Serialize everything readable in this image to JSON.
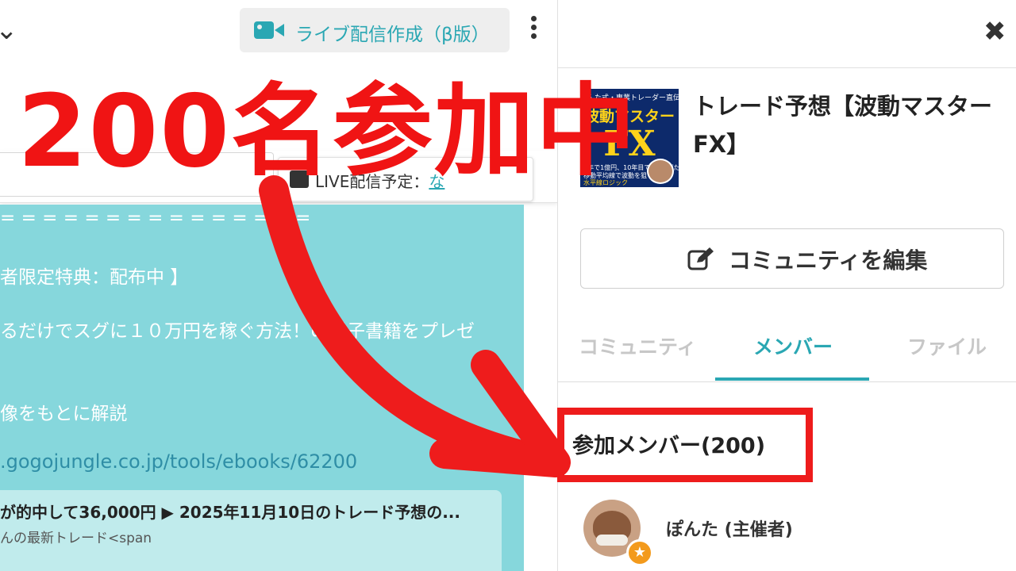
{
  "left_pane": {
    "top_bar": {
      "chevron_glyph": "⌄",
      "live_button_label": "ライブ配信作成（β版）"
    },
    "schedule": {
      "text": "LIVE配信予定：",
      "link_text": "な"
    },
    "post_lines": [
      "= = = = = = = = = = = = = = =",
      "者限定特典：配布中 】",
      "るだけでスグに１０万円を稼ぐ方法！の電子書籍をプレゼ",
      "像をもとに解説"
    ],
    "post_url": ".gogojungle.co.jp/tools/ebooks/62200",
    "card": {
      "title": "が的中して36,000円 ▶ 2025年11月10日のトレード予想の...",
      "subtitle": "んの最新トレード<span"
    }
  },
  "right_pane": {
    "close_glyph": "✖",
    "thumbnail": {
      "top_text": "ぽんた式・専業トレーダー直伝！",
      "main_text": "波動マスター",
      "fx_text": "FX",
      "line1": "5年で1億円、10年目で2億稼げた",
      "line2": "移動平均線で波動を狙う",
      "line3": "水平線ロジック"
    },
    "community_title": "トレード予想【波動マスターFX】",
    "edit_button_label": "コミュニティを編集",
    "tabs": [
      {
        "label": "コミュニティ",
        "state": "inactive"
      },
      {
        "label": "メンバー",
        "state": "active"
      },
      {
        "label": "ファイル",
        "state": "inactive"
      }
    ],
    "members_heading": "参加メンバー(200)",
    "members": [
      {
        "name": "ぽんた (主催者)",
        "badge": "★"
      }
    ]
  },
  "overlay": {
    "headline": "200名参加中",
    "colors": {
      "red": "#ee1c1c",
      "teal": "#2aa7b3"
    }
  }
}
